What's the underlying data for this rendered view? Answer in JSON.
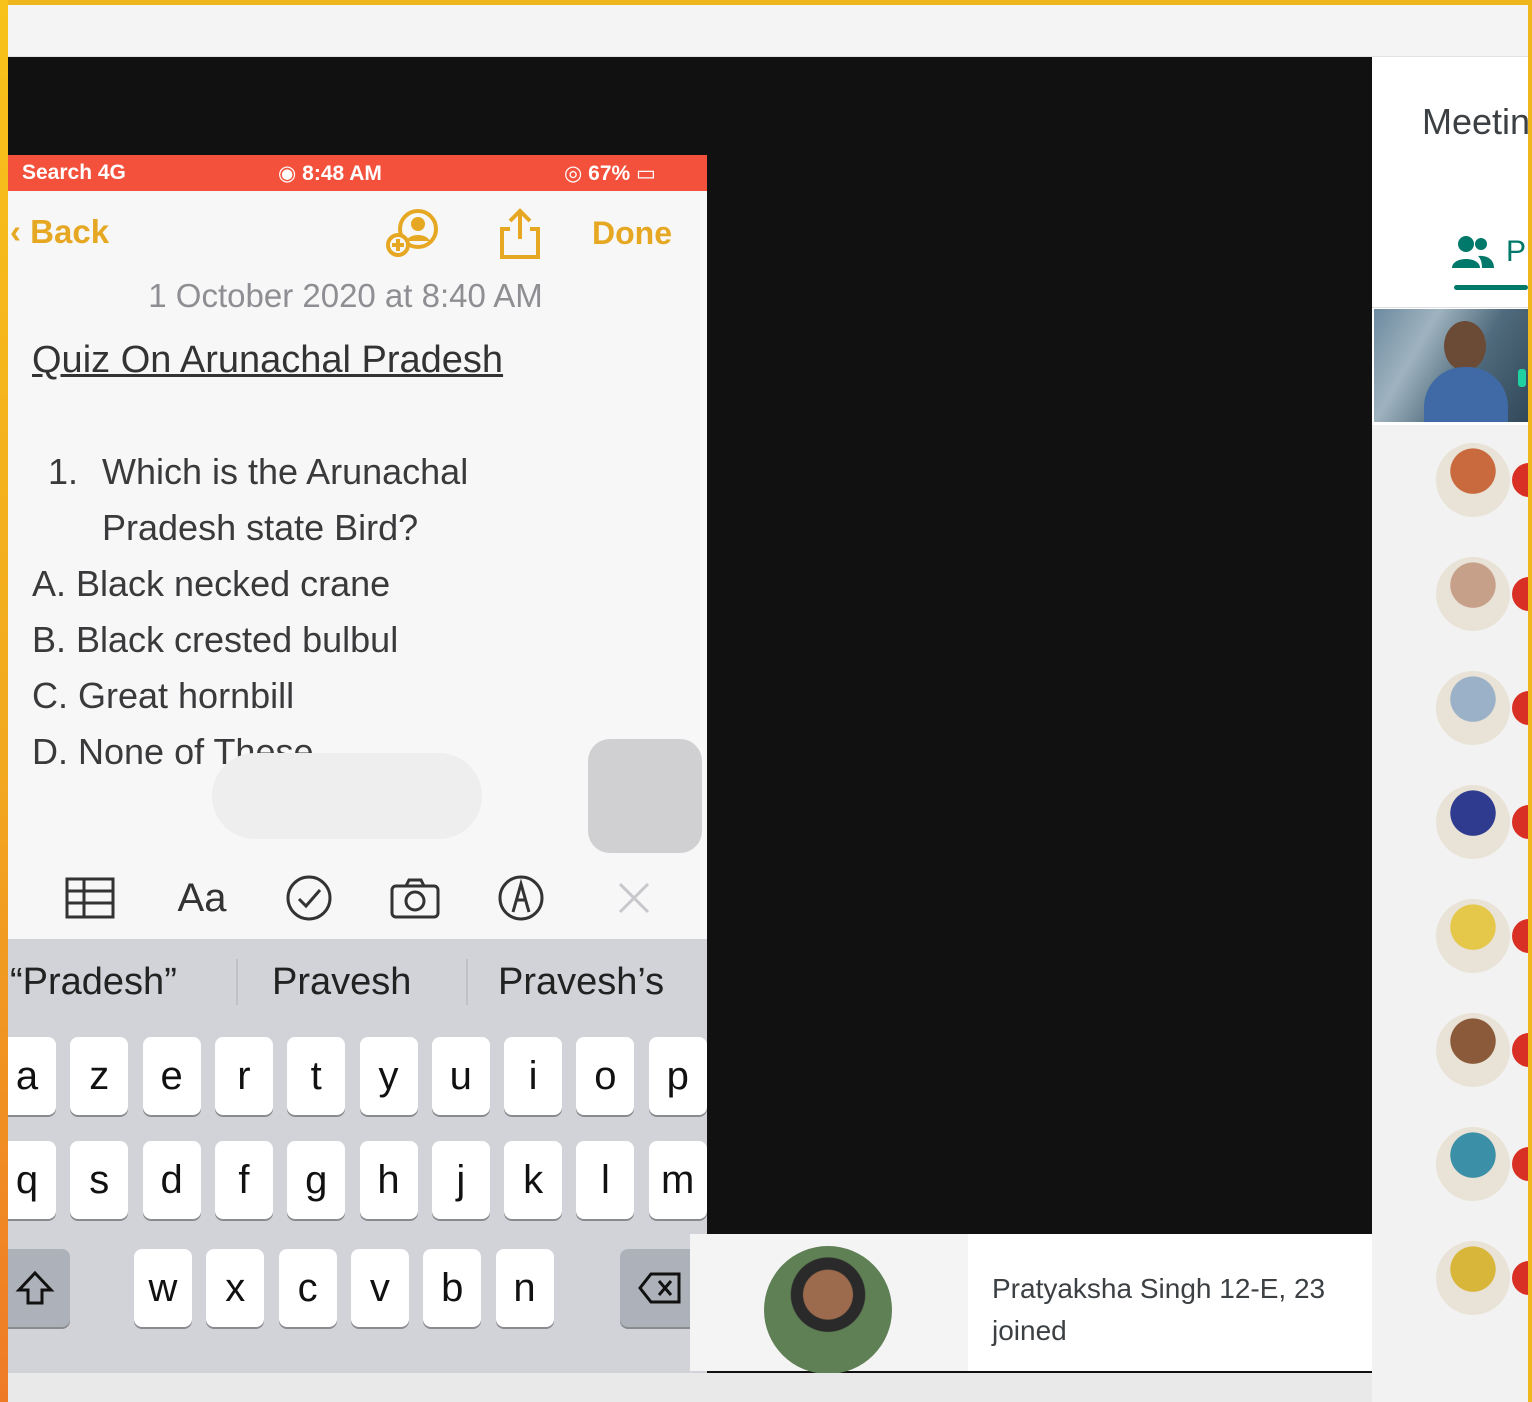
{
  "meeting": {
    "panel_title": "Meetin",
    "people_tab_label": "P",
    "toast": {
      "line1": "Pratyaksha Singh 12-E, 23",
      "line2": "joined"
    },
    "participants": [
      {
        "avatar_color": "#c96a3e"
      },
      {
        "avatar_color": "#c7a08a"
      },
      {
        "avatar_color": "#9bb1c7"
      },
      {
        "avatar_color": "#2e3b8f"
      },
      {
        "avatar_color": "#e5c74a"
      },
      {
        "avatar_color": "#8a5a3a"
      },
      {
        "avatar_color": "#3b8fa6"
      },
      {
        "avatar_color": "#d8b63a"
      }
    ]
  },
  "phone": {
    "status": {
      "left": "Search 4G",
      "time": "8:48 AM",
      "battery": "67%"
    },
    "nav": {
      "back_label": "Back",
      "done_label": "Done"
    },
    "note": {
      "date": "1 October 2020 at 8:40 AM",
      "title": "Quiz On Arunachal Pradesh",
      "question_number": "1.",
      "question_line1": "Which is the Arunachal",
      "question_line2": "Pradesh state Bird?",
      "option_a": "A. Black necked crane",
      "option_b": "B. Black crested bulbul",
      "option_c": "C. Great hornbill",
      "option_d": "D. None of These"
    },
    "toolbar": {
      "format_label": "Aa"
    },
    "keyboard": {
      "suggestions": [
        "“Pradesh”",
        "Pravesh",
        "Pravesh’s"
      ],
      "row1": [
        "a",
        "z",
        "e",
        "r",
        "t",
        "y",
        "u",
        "i",
        "o",
        "p"
      ],
      "row2": [
        "q",
        "s",
        "d",
        "f",
        "g",
        "h",
        "j",
        "k",
        "l",
        "m"
      ],
      "row3": [
        "w",
        "x",
        "c",
        "v",
        "b",
        "n"
      ]
    }
  },
  "colors": {
    "accent": "#e6a823",
    "status_bar": "#f4513c",
    "meet_green": "#00796b",
    "badge_red": "#d93025"
  }
}
